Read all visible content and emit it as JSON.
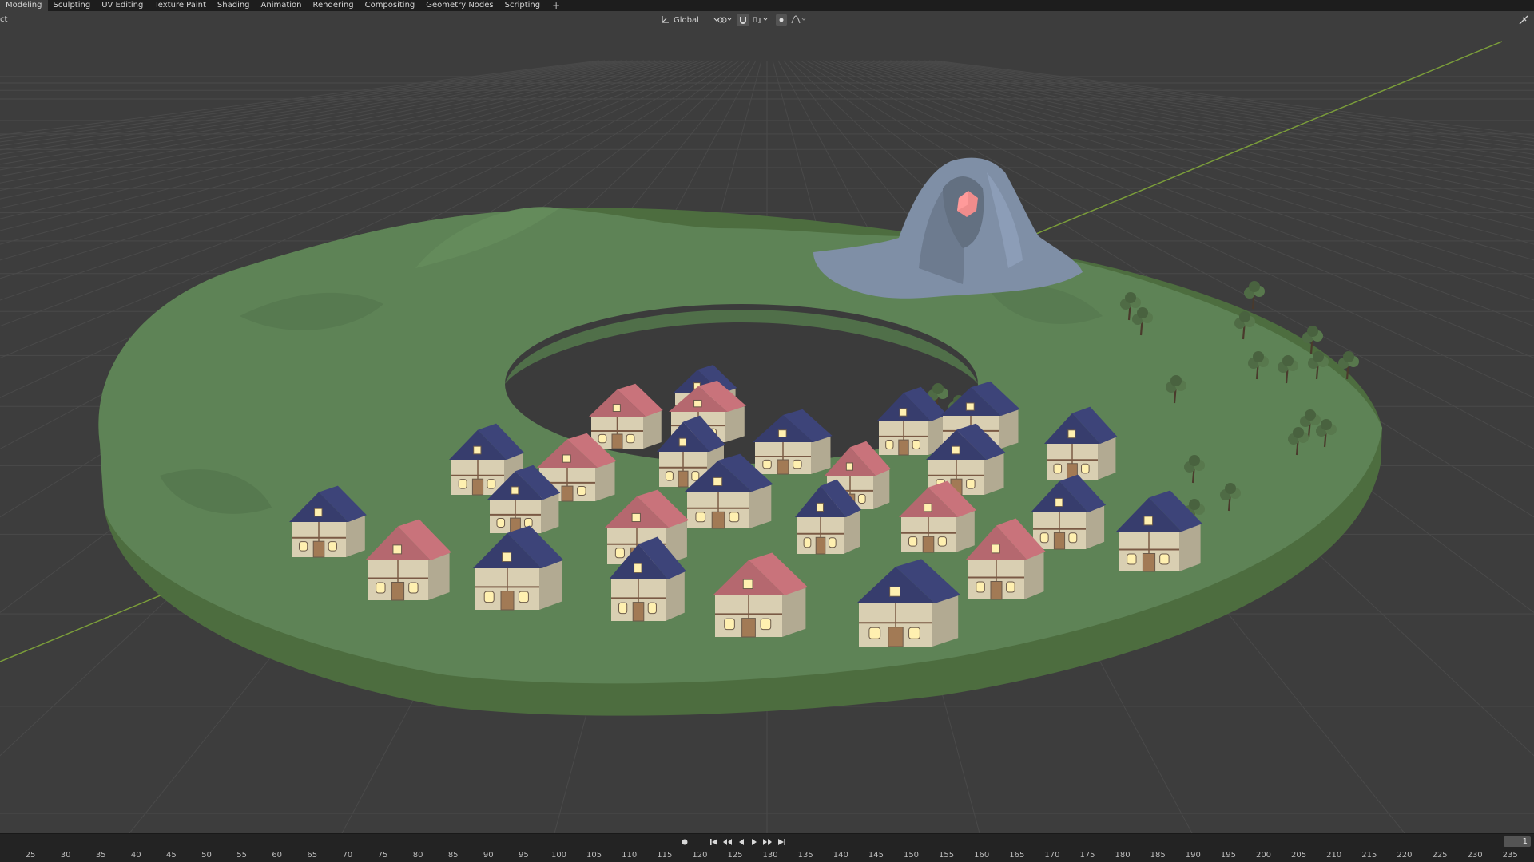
{
  "workspace_tabs": [
    "Modeling",
    "Sculpting",
    "UV Editing",
    "Texture Paint",
    "Shading",
    "Animation",
    "Rendering",
    "Compositing",
    "Geometry Nodes",
    "Scripting"
  ],
  "workspace_add_label": "+",
  "header": {
    "left_fragment": "ct",
    "transform_orientation": "Global"
  },
  "colors": {
    "background": "#3d3d3d",
    "grid": "#4a4a4a",
    "x_axis": "#7a9c3a",
    "terrain": "#5e8356",
    "terrain_rim": "#4d6d3f",
    "mountain": "#7f8fa6",
    "crystal": "#f08c8c",
    "roof_blue": "#3d4479",
    "roof_red": "#c9737b",
    "wall": "#d9cfb2",
    "timber": "#7a5a45",
    "window_glow": "#fff0b0",
    "tree_foliage": "#4f6b45"
  },
  "scene": {
    "objects": [
      "terrain-ring",
      "mountain",
      "crystal",
      "houses",
      "trees"
    ]
  },
  "timeline": {
    "current_frame": "1",
    "ruler_ticks": [
      "25",
      "30",
      "35",
      "40",
      "45",
      "50",
      "55",
      "60",
      "65",
      "70",
      "75",
      "80",
      "85",
      "90",
      "95",
      "100",
      "105",
      "110",
      "115",
      "120",
      "125",
      "130",
      "135",
      "140",
      "145",
      "150",
      "155",
      "160",
      "165",
      "170",
      "175",
      "180",
      "185",
      "190",
      "195",
      "200",
      "205",
      "210",
      "215",
      "220",
      "225",
      "230",
      "235"
    ]
  }
}
